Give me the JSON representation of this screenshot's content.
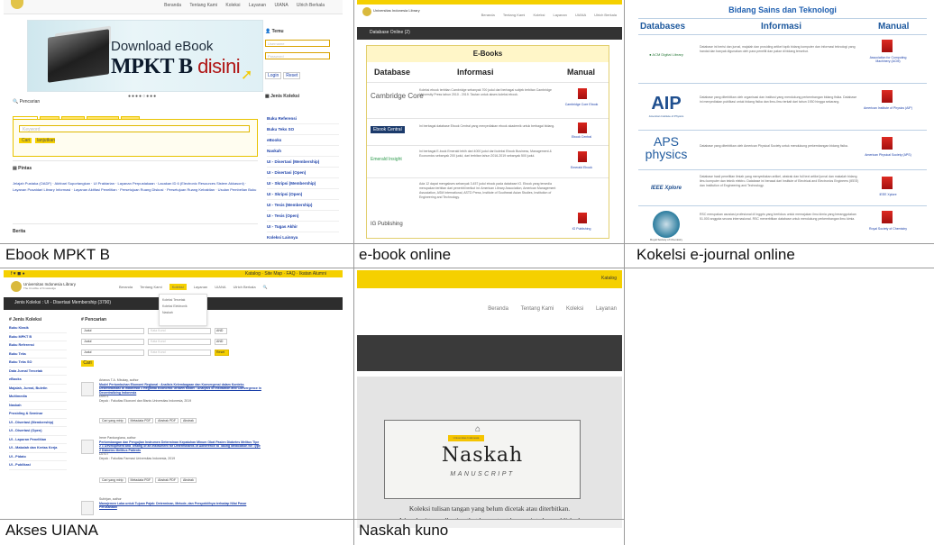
{
  "captions": {
    "c1": "Ebook MPKT B",
    "c2": "e-book online",
    "c3": "Kokelsi e-journal online",
    "c4": "Akses UIANA",
    "c5": "Naskah kuno"
  },
  "ebook_mpkt": {
    "nav": [
      "Beranda",
      "Tentang Kami",
      "Koleksi",
      "Layanan",
      "UIANA",
      "Ulrich Berkala"
    ],
    "banner_line1": "Download eBook",
    "banner_line2": "MPKT B",
    "banner_emph": "disini",
    "search_label": "Pencarian",
    "tabs": [
      "Sederhana",
      "Spesifik",
      "Sumberna",
      "Google Custom",
      "Berkala"
    ],
    "search_placeholder": "Keyword",
    "btn_cari": "Cari",
    "btn_lanjut": "lanjutkan",
    "fast_label": "Pintas",
    "fast_links": "Jelajah Pustaka (OADF)  ·  Akhbari Suportangkan  ·  UI Praktarian  ·  Layanan Perpustakaan  ·  Lacakan ID 6 (Electronic Resources Sistem Akkasoni)  ·  Layanan Pusatdari Library Informasi  ·  Layanan Aktifasi Penelitian  ·  Persetujuan Ruang Diskusi  ·  Persetujuan Ruang Kebaktian  ·  Usulan Pembelian Buku",
    "berita_label": "Berita",
    "login_label": "Temu",
    "username_ph": "Username",
    "password_ph": "Password",
    "login_btn": "Login",
    "reset_btn": "Reset",
    "jenis_label": "Jenis Koleksi",
    "koleksi": [
      "Buku Referensi",
      "Buku Teks SO",
      "eBooks",
      "Naskah",
      "UI - Disertasi (Membership)",
      "UI - Disertasi (Open)",
      "UI - Skripsi (Membership)",
      "UI - Skripsi (Open)",
      "UI - Tesis (Membership)",
      "UI - Tesis (Open)",
      "UI - Tugas Akhir",
      "Koleksi Lainnya"
    ]
  },
  "ebook_online": {
    "logo_text": "Universitas Indonesia Library",
    "nav": [
      "Beranda",
      "Tentang Kami",
      "Koleksi",
      "Layanan",
      "UIANA",
      "Ulrich Berkala"
    ],
    "section": "Database Online (2)",
    "panel_title": "E-Books",
    "headers": [
      "Database",
      "Informasi",
      "Manual"
    ],
    "rows": [
      {
        "db": "Cambridge Core",
        "info": "Koleksi ebook terbitan Cambridge sebanyak 700 judul dari berbagai subjek terbitan Cambridge University Press tahun 2010 - 2019. Tautan untuk akses koleksi ebook.",
        "manual": "Cambridge Core Ebook"
      },
      {
        "db": "Ebook Central",
        "info": "Ini berbagai database Ebook Central yang menyediakan ebook akademik untuk berbagai bidang.",
        "manual": "Ebook Central"
      },
      {
        "db": "Emerald Insight",
        "info": "Ini berbagai E-book Emerald lebih dari 4000 judul dari koleksi Ebook Business, Management & Economics sebanyak 200 judul, dari terbitan tahun 2016-2019 sebanyak 500 judul.",
        "manual": "Emerald Ebook"
      },
      {
        "db": "IG Publishing",
        "info": "Ada 12 dapat mengakses sebanyak 3.457 judul ebook pada database IG. Ebook yang tersedia merupakan terbitan dari penerbit berikut ini: American Library Association, American Management Association, ASM International, ASTD Press, Institute of Southeast Asian Studies, Institution of Engineering and Technology.",
        "manual": "IG Publishing"
      }
    ]
  },
  "ejournal": {
    "title": "Bidang Sains dan Teknologi",
    "headers": [
      "Databases",
      "Informasi",
      "Manual"
    ],
    "rows": [
      {
        "db": "ACM Digital Library",
        "info": "Database ini berisi dan jurnal, majalah dan prosiding artikel topik bidang komputer dan informasi teknologi yang handal dan banyak digunakan oleh para peneliti dan pakar di bidang tersebut.",
        "manual": "Association for Computing Machinery (ACM)"
      },
      {
        "db": "AIP",
        "sub": "American Institute of Physics",
        "info": "Database yang diterbitkan oleh organisasi dan institusi yang mendukung perkembangan bidang fisika. Database ini menyediakan publikasi untuk bidang fisika dan ilmu-ilmu terkait dari tahun 1930 hingga sekarang.",
        "manual": "American Institute of Physics (AIP)"
      },
      {
        "db": "APS physics",
        "info": "Database yang diterbitkan oleh American Physical Society untuk mendukung perkembangan bidang fisika.",
        "manual": "American Physical Society (APS)"
      },
      {
        "db": "IEEE Xplore",
        "info": "Database hasil penelitian ilmiah yang menyediakan artikel, abstrak dan full text artikel jurnal dan makalah bidang ilmu komputer dan teknik elektro. Database ini berasal dari Institute of Electrical and Electronics Engineers (IEEE) dan Institution of Engineering and Technology.",
        "manual": "IEEE Xplore"
      },
      {
        "db": "Royal Society of Chemistry",
        "info": "RSC merupakan asosiasi profesional di Inggris yang berfokus untuk memajukan ilmu kimia yang beranggotakan 51.000 anggota secara internasional. RSC menerbitkan database untuk mendukung perkembangan ilmu kimia.",
        "manual": "Royal Society of Chemistry"
      }
    ]
  },
  "uiana": {
    "logo_text": "Universitas Indonesia Library",
    "tagline": "The Crucible of Knowledge",
    "top_links": [
      "Katalog",
      "Site Map",
      "FAQ",
      "Ikatan Alumni"
    ],
    "nav": [
      "Beranda",
      "Tentang Kami",
      "Koleksi",
      "Layanan",
      "UIANA",
      "Ulrich Berkala"
    ],
    "dropdown": [
      "Koleksi Tercetak",
      "Koleksi Elektronik",
      "Naskah"
    ],
    "header": "Jenis Koleksi : UI - Disertasi Membership (3790)",
    "side_title": "Jenis Koleksi",
    "side": [
      "Buku Klasik",
      "Buku MPKT B",
      "Buku Referensi",
      "Buku Teks",
      "Buku Teks SO",
      "Data Jurnal Tercetak",
      "eBooks",
      "Majalah, Jurnal, Buletin",
      "Multimedia",
      "Naskah",
      "Prosiding & Seminar",
      "UI - Disertasi (Membership)",
      "UI - Disertasi (Open)",
      "UI - Laporan Penelitian",
      "UI - Makalah dan Kertas Kerja",
      "UI - Pidato",
      "UI - Publikasi"
    ],
    "search_title": "Pencarian",
    "search_rows": [
      {
        "field": "Judul",
        "kw": "Kata Kunci",
        "op": "AND"
      },
      {
        "field": "Judul",
        "kw": "Kata Kunci",
        "op": "AND"
      },
      {
        "field": "Judul",
        "kw": "Kata Kunci",
        "op": ""
      }
    ],
    "btn": "Cari",
    "btn_reset": "Reset",
    "results": [
      {
        "author": "Arianus T.A. Mbukay, author",
        "title": "Model Pertumbuhan Ekonomi Regional : Analisis Kelembagaan dan Konvergensi dalam Konteks Desentralisasi di Indonesia = Regional Economic Growth Model : Analysis of Institution and Convergence in Decentralizing Indonesia",
        "id": "D2571",
        "src": "Depok : Fakultas Ekonomi dan Bisnis Universitas Indonesia, 2019"
      },
      {
        "author": "Irene Pardungiana, author",
        "title": "Perkembangan dan Pengujian Instrumen Determinan Kepatuhan Minum Obat Pasien Diabetes Melitus Tipe 2 = Development and Testing of an Instrument for Determinants of Adherence to Taking Medication for Type 2 Diabetes Mellitus Patients",
        "id": "D2707",
        "src": "Depok : Fakultas Farmasi Universitas Indonesia, 2019"
      },
      {
        "author": "Suhirjan, author",
        "title": "Manajemen Laba untuk Tujuan Pajak: Determinan, Metode, dan Perspektifnya terhadap Nilai Pasar Perusahaan",
        "id": "",
        "src": ""
      }
    ],
    "result_buttons": [
      "Cari yang mirip",
      "Metadata PDF",
      "Abstrak PDF",
      "Abstrak"
    ]
  },
  "naskah": {
    "top": "Katalog",
    "nav": [
      "Beranda",
      "Tentang Kami",
      "Koleksi",
      "Layanan"
    ],
    "tag": "Universitas Indonesia",
    "title": "Naskah",
    "subtitle": "MANUSCRIPT",
    "desc_id": "Koleksi tulisan tangan yang belum dicetak atau diterbitkan.",
    "desc_en": "A handwritten collection that has not yet been printed or published."
  }
}
